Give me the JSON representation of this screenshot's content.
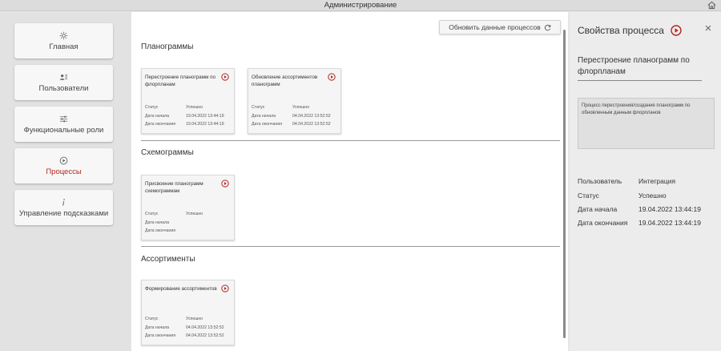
{
  "window": {
    "title": "Администрирование",
    "home_icon": "home-icon"
  },
  "sidebar": {
    "items": [
      {
        "label": "Главная",
        "icon": "gear-icon"
      },
      {
        "label": "Пользователи",
        "icon": "users-icon"
      },
      {
        "label": "Функциональные роли",
        "icon": "sliders-icon"
      },
      {
        "label": "Процессы",
        "icon": "play-circle-icon",
        "active": true
      },
      {
        "label": "Управление подсказками",
        "icon": "info-icon"
      }
    ]
  },
  "main": {
    "refresh_label": "Обновить данные процессов",
    "field_labels": {
      "status": "Статус",
      "start": "Дата начала",
      "end": "Дата окончания"
    },
    "sections": [
      {
        "title": "Планограммы",
        "cards": [
          {
            "title": "Перестроение планограмм по флорпланам",
            "status": "Успешно",
            "start": "19.04.2022 13:44:19",
            "end": "19.04.2022 13:44:19"
          },
          {
            "title": "Обновление ассортиментов планограмм",
            "status": "Успешно",
            "start": "04.04.2022 13:52:52",
            "end": "04.04.2022 13:52:52"
          }
        ]
      },
      {
        "title": "Схемограммы",
        "cards": [
          {
            "title": "Присвоение планограмм схемограммам",
            "status": "Успешно",
            "start": "",
            "end": ""
          }
        ]
      },
      {
        "title": "Ассортименты",
        "cards": [
          {
            "title": "Формирование ассортиментов",
            "status": "Успешно",
            "start": "04.04.2022 13:52:52",
            "end": "04.04.2022 13:52:52"
          }
        ]
      }
    ]
  },
  "panel": {
    "title": "Свойства процесса",
    "process_name": "Перестроение планограмм по флорпланам",
    "description": "Процесс перестроения/создания планограмм по обновленным данным флорпланов",
    "props": [
      {
        "label": "Пользователь",
        "value": "Интеграция"
      },
      {
        "label": "Статус",
        "value": "Успешно"
      },
      {
        "label": "Дата начала",
        "value": "19.04.2022 13:44:19"
      },
      {
        "label": "Дата окончания",
        "value": "19.04.2022 13:44:19"
      }
    ]
  },
  "colors": {
    "accent": "#b3261e",
    "main_bg": "#ffffff",
    "sidebar_bg": "#e2e2e2",
    "panel_bg": "#ececec"
  }
}
